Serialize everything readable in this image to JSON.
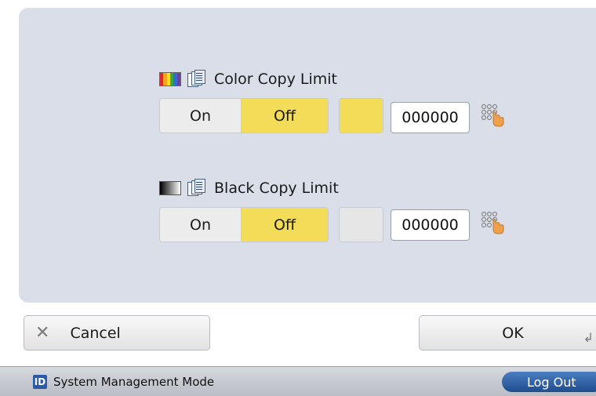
{
  "color_limit": {
    "title": "Color Copy Limit",
    "on_label": "On",
    "off_label": "Off",
    "selected": "Off",
    "value": "000000",
    "swatch_color": "#f3dc58"
  },
  "black_limit": {
    "title": "Black Copy Limit",
    "on_label": "On",
    "off_label": "Off",
    "selected": "Off",
    "value": "000000",
    "swatch_color": "#e6e6e6"
  },
  "buttons": {
    "cancel_label": "Cancel",
    "ok_label": "OK"
  },
  "statusbar": {
    "mode_text": "System Management Mode",
    "id_icon_text": "ID",
    "logout_label": "Log Out"
  },
  "icons": {
    "color_bars": "color-bars-icon",
    "bw_gradient": "black-gradient-icon",
    "documents": "documents-icon",
    "keypad": "keypad-icon",
    "cancel": "close-icon",
    "enter": "enter-icon"
  },
  "colors": {
    "selected_toggle": "#f3dc58",
    "panel_bg": "#d9dee9",
    "logout_bg": "#2b5fa6"
  }
}
